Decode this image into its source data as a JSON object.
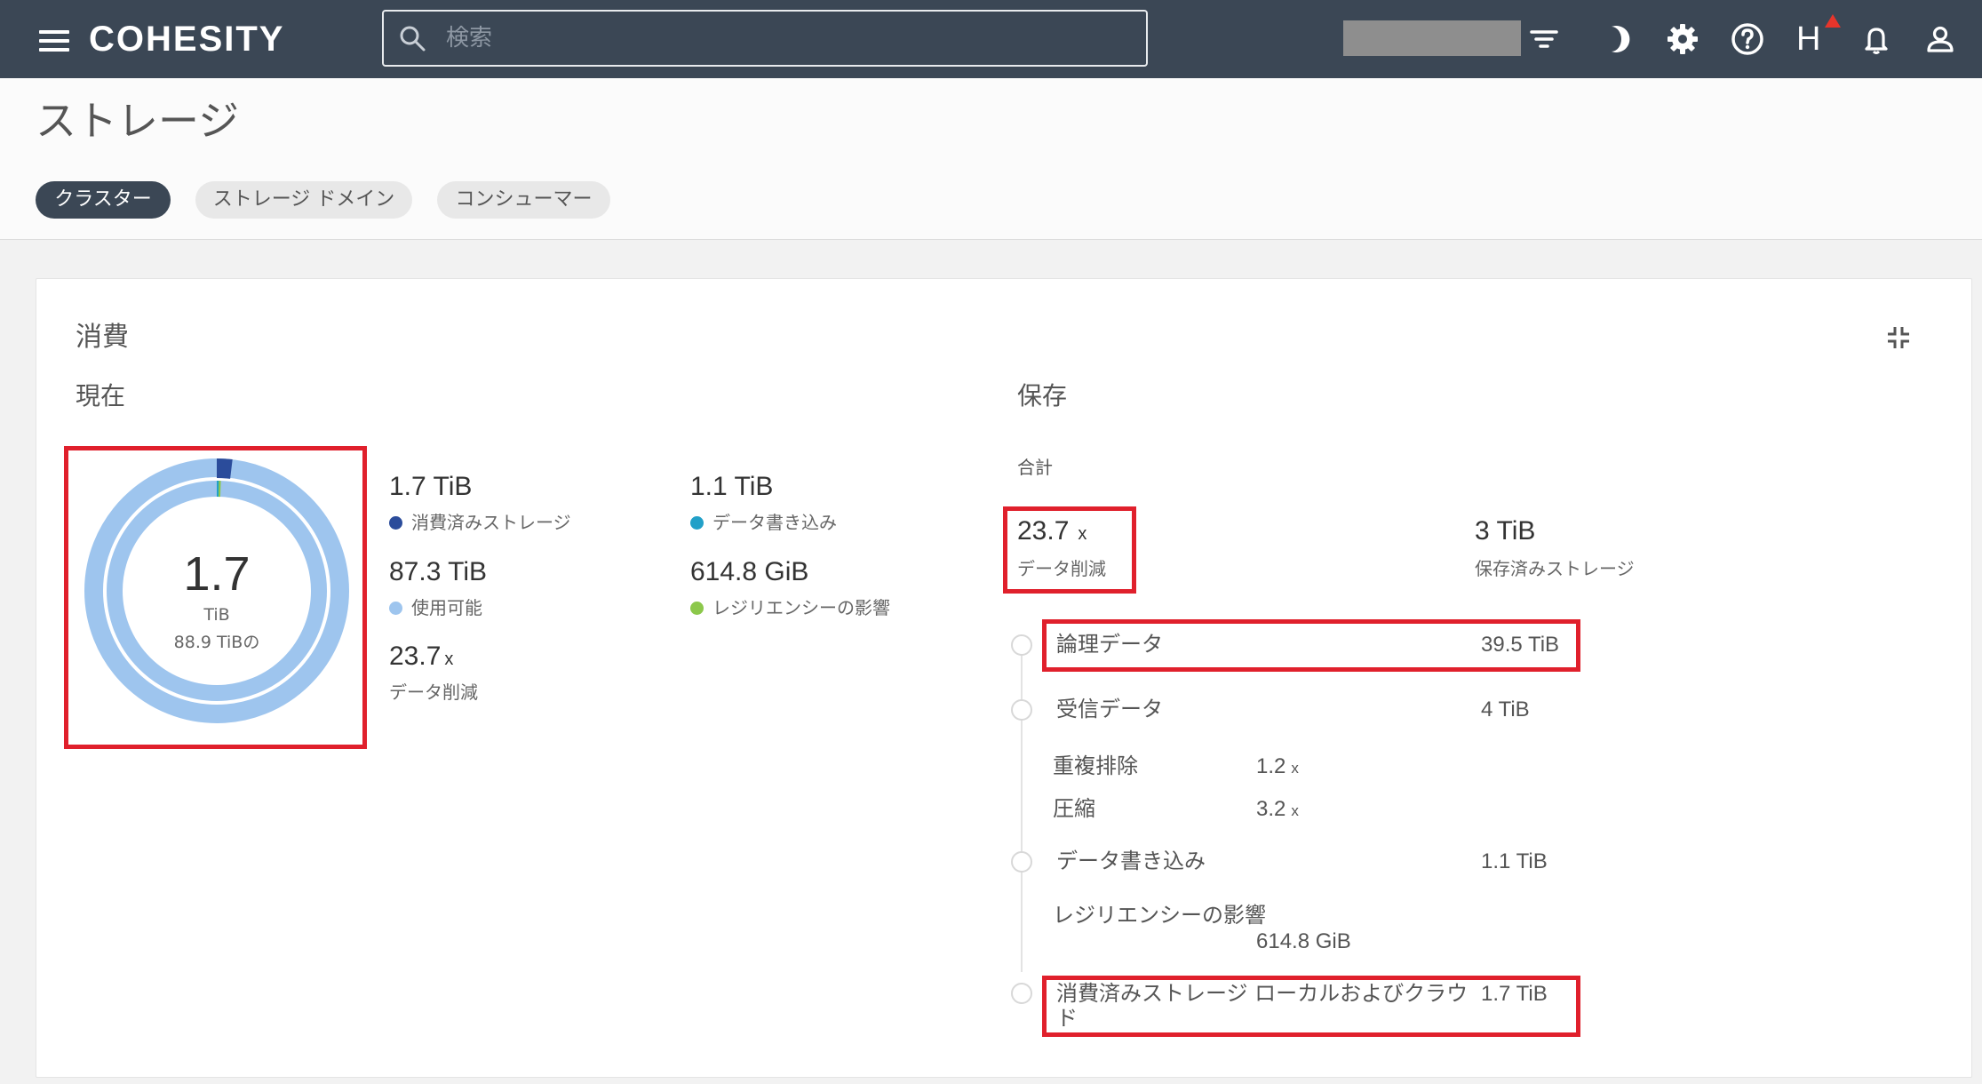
{
  "topbar": {
    "brand": "COHESITY",
    "search_placeholder": "検索",
    "user_initial": "H",
    "icons": [
      "menu-icon",
      "search-icon",
      "filter-icon",
      "moon-icon",
      "gear-icon",
      "help-icon",
      "bell-icon",
      "user-icon"
    ]
  },
  "page": {
    "title": "ストレージ",
    "tabs": [
      {
        "label": "クラスター",
        "active": true
      },
      {
        "label": "ストレージ ドメイン",
        "active": false
      },
      {
        "label": "コンシューマー",
        "active": false
      }
    ]
  },
  "card": {
    "title": "消費",
    "current": {
      "label": "現在",
      "donut": {
        "value": "1.7",
        "unit": "TiB",
        "of": "88.9 TiBの",
        "used_fraction": 0.019,
        "colors": {
          "consumed": "#2b4c9b",
          "write": "#22a0c8",
          "resilience": "#8cc84b",
          "available": "#9ec5ee"
        }
      },
      "stats": [
        {
          "value": "1.7 TiB",
          "label": "消費済みストレージ",
          "color": "#2b4c9b"
        },
        {
          "value": "1.1 TiB",
          "label": "データ書き込み",
          "color": "#22a0c8"
        },
        {
          "value": "87.3 TiB",
          "label": "使用可能",
          "color": "#9ec5ee"
        },
        {
          "value": "614.8 GiB",
          "label": "レジリエンシーの影響",
          "color": "#8cc84b"
        }
      ],
      "reduction": {
        "value": "23.7",
        "suffix": "x",
        "label": "データ削減"
      }
    },
    "saved": {
      "label": "保存",
      "total_label": "合計",
      "reduction": {
        "value": "23.7",
        "suffix": "x",
        "label": "データ削減"
      },
      "saved_storage": {
        "value": "3 TiB",
        "label": "保存済みストレージ"
      },
      "rows": {
        "logical": {
          "label": "論理データ",
          "value": "39.5 TiB"
        },
        "received": {
          "label": "受信データ",
          "value": "4 TiB"
        },
        "dedup": {
          "label": "重複排除",
          "value": "1.2",
          "suffix": "x"
        },
        "compress": {
          "label": "圧縮",
          "value": "3.2",
          "suffix": "x"
        },
        "write": {
          "label": "データ書き込み",
          "value": "1.1 TiB"
        },
        "resilience": {
          "label": "レジリエンシーの影響",
          "value": "614.8 GiB"
        },
        "consumed": {
          "label": "消費済みストレージ ローカルおよびクラウド",
          "value": "1.7 TiB"
        }
      }
    }
  }
}
